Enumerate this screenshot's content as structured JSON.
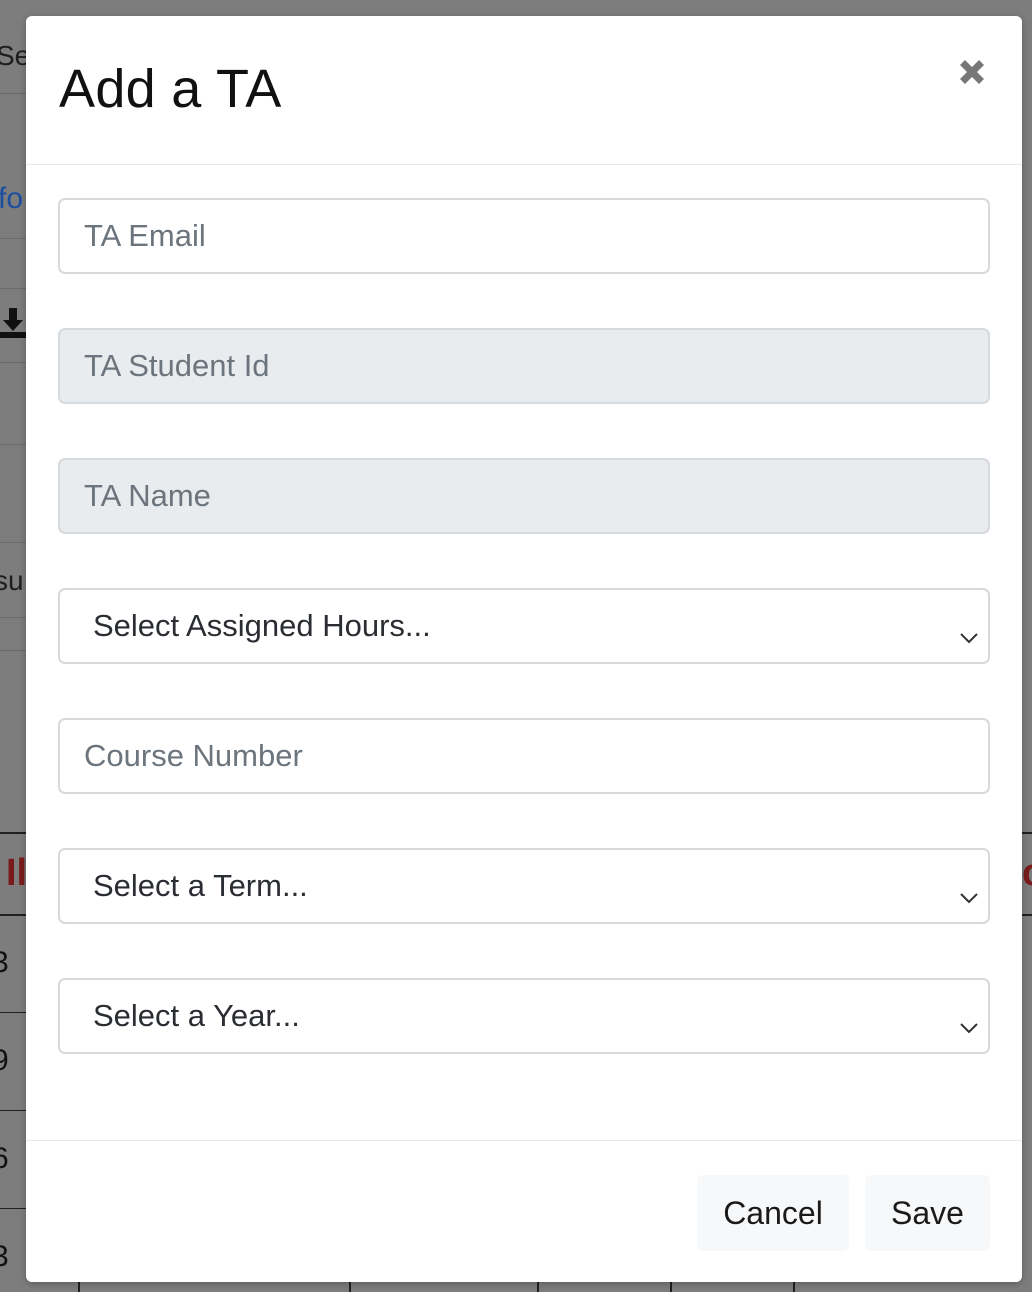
{
  "background": {
    "fragments": [
      "Sel",
      "fo",
      "su",
      "Il",
      "3",
      "9",
      "6",
      "3"
    ],
    "right_fragment": "c"
  },
  "modal": {
    "title": "Add a TA",
    "close_icon": "close-icon",
    "fields": {
      "ta_email": {
        "placeholder": "TA Email",
        "value": ""
      },
      "ta_student_id": {
        "placeholder": "TA Student Id",
        "value": ""
      },
      "ta_name": {
        "placeholder": "TA Name",
        "value": ""
      },
      "assigned_hours": {
        "selected": "Select Assigned Hours..."
      },
      "course_number": {
        "placeholder": "Course Number",
        "value": ""
      },
      "term": {
        "selected": "Select a Term..."
      },
      "year": {
        "selected": "Select a Year..."
      }
    },
    "footer": {
      "cancel_label": "Cancel",
      "save_label": "Save"
    }
  },
  "colors": {
    "overlay": "#7d7d7d",
    "disabled_bg": "#e9ecef",
    "border": "#d7dadd",
    "background_link": "#1d4fa0",
    "background_header": "#7a1a1a"
  }
}
